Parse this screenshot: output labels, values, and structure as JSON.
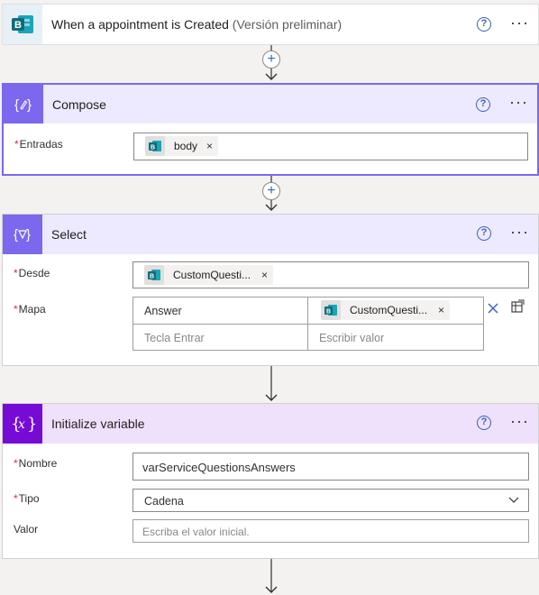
{
  "trigger": {
    "title": "When a appointment is Created",
    "subtitle": "(Versión preliminar)",
    "icon": "bookings-icon",
    "accent": "#0f7f8a"
  },
  "compose": {
    "title": "Compose",
    "icon": "compose-icon",
    "accent": "#7b68ee",
    "header_bg": "#ede9ff",
    "fields": {
      "entradas_label": "Entradas",
      "entradas_token": "body"
    }
  },
  "select": {
    "title": "Select",
    "icon": "select-icon",
    "accent": "#7b68ee",
    "header_bg": "#ede9ff",
    "desde_label": "Desde",
    "desde_token": "CustomQuesti...",
    "mapa_label": "Mapa",
    "mapa_key": "Answer",
    "mapa_value_token": "CustomQuesti...",
    "key_placeholder": "Tecla Entrar",
    "value_placeholder": "Escribir valor"
  },
  "init_var": {
    "title": "Initialize variable",
    "icon": "variable-icon",
    "accent": "#770bd6",
    "header_bg": "#efe0fb",
    "nombre_label": "Nombre",
    "nombre_value": "varServiceQuestionsAnswers",
    "tipo_label": "Tipo",
    "tipo_value": "Cadena",
    "valor_label": "Valor",
    "valor_placeholder": "Escriba el valor inicial."
  },
  "common": {
    "help_glyph": "?",
    "more_glyph": "···",
    "required_mark": "*",
    "token_remove": "×",
    "add_step": "+"
  }
}
